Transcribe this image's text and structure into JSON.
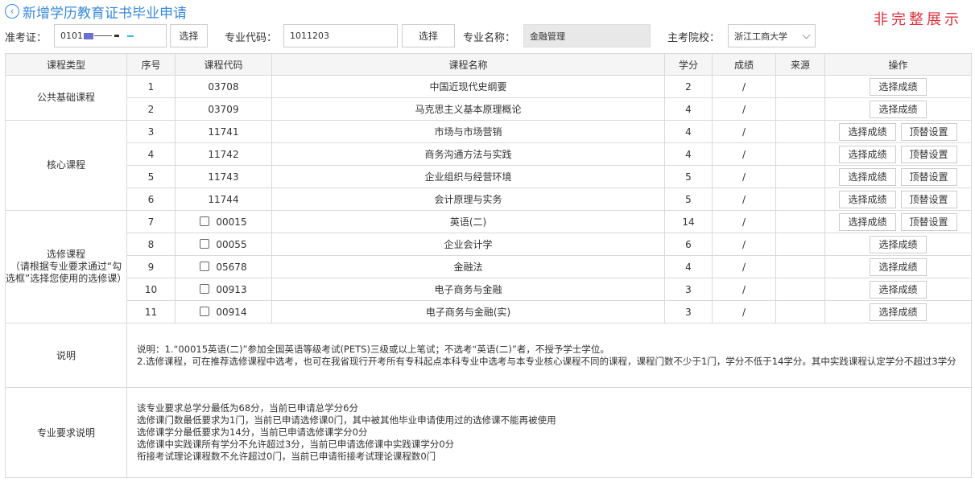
{
  "header": {
    "back_icon": "circle-chevron-left-icon",
    "title": "新增学历教育证书毕业申请",
    "watermark": "非完整展示"
  },
  "form": {
    "exam_no_label": "准考证：",
    "exam_no_value": "0101",
    "select_label": "选择",
    "major_code_label": "专业代码：",
    "major_code_value": "1011203",
    "major_name_label": "专业名称：",
    "major_name_value": "金融管理",
    "school_label": "主考院校：",
    "school_value": "浙江工商大学"
  },
  "table": {
    "headers": [
      "课程类型",
      "序号",
      "课程代码",
      "课程名称",
      "学分",
      "成绩",
      "来源",
      "操作"
    ],
    "groups": [
      {
        "type": "公共基础课程"
      },
      {
        "type": "核心课程"
      },
      {
        "type": "选修课程",
        "type_note": "（请根据专业要求通过“勾选框”选择您使用的选修课）"
      }
    ],
    "rows": [
      {
        "no": "1",
        "code": "03708",
        "name": "中国近现代史纲要",
        "credit": "2",
        "score": "/",
        "source": ""
      },
      {
        "no": "2",
        "code": "03709",
        "name": "马克思主义基本原理概论",
        "credit": "4",
        "score": "/",
        "source": ""
      },
      {
        "no": "3",
        "code": "11741",
        "name": "市场与市场营销",
        "credit": "4",
        "score": "/",
        "source": ""
      },
      {
        "no": "4",
        "code": "11742",
        "name": "商务沟通方法与实践",
        "credit": "4",
        "score": "/",
        "source": ""
      },
      {
        "no": "5",
        "code": "11743",
        "name": "企业组织与经营环境",
        "credit": "5",
        "score": "/",
        "source": ""
      },
      {
        "no": "6",
        "code": "11744",
        "name": "会计原理与实务",
        "credit": "5",
        "score": "/",
        "source": ""
      },
      {
        "no": "7",
        "code": "00015",
        "name": "英语(二)",
        "credit": "14",
        "score": "/",
        "source": ""
      },
      {
        "no": "8",
        "code": "00055",
        "name": "企业会计学",
        "credit": "6",
        "score": "/",
        "source": ""
      },
      {
        "no": "9",
        "code": "05678",
        "name": "金融法",
        "credit": "4",
        "score": "/",
        "source": ""
      },
      {
        "no": "10",
        "code": "00913",
        "name": "电子商务与金融",
        "credit": "3",
        "score": "/",
        "source": ""
      },
      {
        "no": "11",
        "code": "00914",
        "name": "电子商务与金融(实)",
        "credit": "3",
        "score": "/",
        "source": ""
      }
    ],
    "select_score_label": "选择成绩",
    "replace_label": "顶替设置"
  },
  "notes": {
    "label": "说明",
    "line1": "说明：1.“00015英语(二)”参加全国英语等级考试(PETS)三级或以上笔试；不选考“英语(二)”者，不授予学士学位。",
    "line2": "2.选修课程，可在推荐选修课程中选考，也可在我省现行开考所有专科起点本科专业中选考与本专业核心课程不同的课程，课程门数不少于1门，学分不低于14学分。其中实践课程认定学分不超过3学分"
  },
  "requirements": {
    "label": "专业要求说明",
    "lines": [
      "该专业要求总学分最低为68分，当前已申请总学分6分",
      "选修课门数最低要求为1门，当前已申请选修课0门，其中被其他毕业申请使用过的选修课不能再被使用",
      "选修课学分最低要求为14分，当前已申请选修课学分0分",
      "选修课中实践课所有学分不允许超过3分，当前已申请选修课中实践课学分0分",
      "衔接考试理论课程数不允许超过0门，当前已申请衔接考试理论课程数0门"
    ]
  }
}
